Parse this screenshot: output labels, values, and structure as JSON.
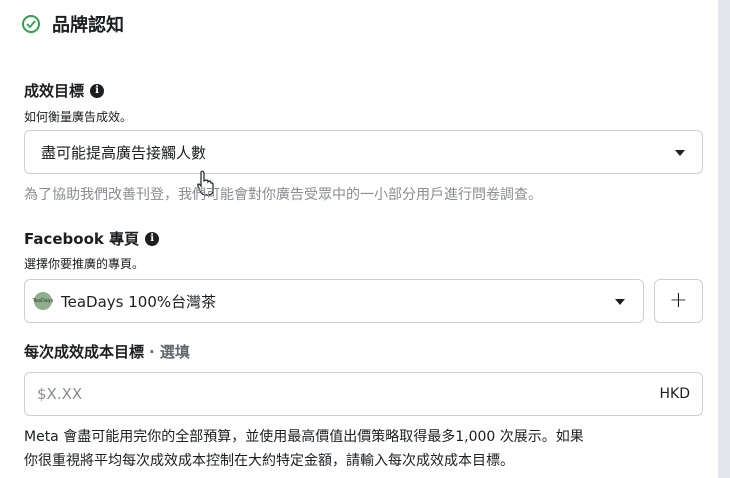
{
  "section": {
    "title": "品牌認知"
  },
  "goal": {
    "label": "成效目標",
    "sublabel": "如何衡量廣告成效。",
    "selected": "盡可能提高廣告接觸人數",
    "hint": "為了協助我們改善刊登，我們可能會對你廣告受眾中的一小部分用戶進行問卷調查。"
  },
  "facebook_page": {
    "label": "Facebook 專頁",
    "sublabel": "選擇你要推廣的專頁。",
    "selected": "TeaDays 100%台灣茶",
    "logo_text": "TeaDays",
    "add_label": "+"
  },
  "cost_goal": {
    "label": "每次成效成本目標",
    "optional": "· 選填",
    "placeholder": "$X.XX",
    "currency": "HKD",
    "description_line1": "Meta 會盡可能用完你的全部預算，並使用最高價值出價策略取得最多1,000 次展示。如果",
    "description_line2": "你很重視將平均每次成效成本控制在大約特定金額，請輸入每次成效成本目標。"
  },
  "colors": {
    "success": "#31a24c",
    "border": "#ccd0d5",
    "muted": "#8a8d91"
  }
}
